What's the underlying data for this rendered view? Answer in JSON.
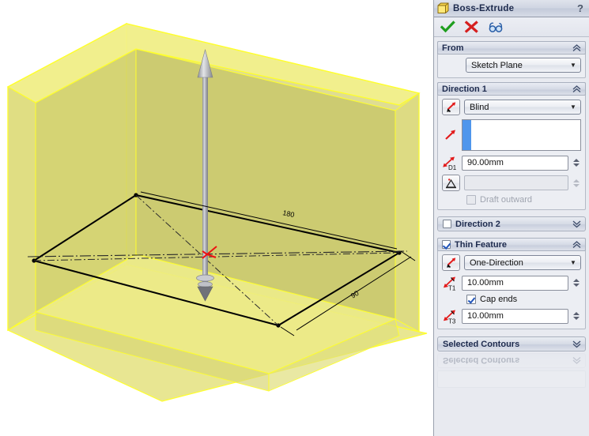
{
  "window": {
    "title": "Boss-Extrude",
    "icon": "boss-extrude-icon",
    "help_label": "?"
  },
  "toolbar": {
    "ok_label": "OK",
    "cancel_label": "Cancel",
    "preview_label": "Detailed Preview"
  },
  "sections": {
    "from": {
      "title": "From",
      "collapse_state": "expanded",
      "start_condition": "Sketch Plane"
    },
    "direction1": {
      "title": "Direction 1",
      "collapse_state": "expanded",
      "reverse_label": "Reverse Direction",
      "end_condition": "Blind",
      "direction_vector": "",
      "depth_label": "D1",
      "depth_value": "90.00mm",
      "draft_label": "Draft Angle",
      "draft_value": "",
      "draft_outward_label": "Draft outward",
      "draft_outward_checked": false
    },
    "direction2": {
      "title": "Direction 2",
      "collapse_state": "collapsed",
      "checked": false
    },
    "thin_feature": {
      "title": "Thin Feature",
      "collapse_state": "expanded",
      "checked": true,
      "reverse_label": "Reverse Direction",
      "thin_type": "One-Direction",
      "t1_label": "T1",
      "t1_value": "10.00mm",
      "cap_ends_label": "Cap ends",
      "cap_ends_checked": true,
      "t3_label": "T3",
      "t3_value": "10.00mm"
    },
    "selected_contours": {
      "title": "Selected Contours",
      "collapse_state": "collapsed",
      "ghost_title": "Selected Contours"
    }
  },
  "viewport": {
    "model_name": "extruded-thin-box-preview",
    "dimension_length": "180",
    "dimension_width": "90",
    "direction_arrow": "extrude-direction-arrow",
    "origin_marker": "sketch-origin"
  },
  "colors": {
    "preview_fill": "#ebe97f",
    "preview_edge": "#ffff22",
    "sketch_edge": "#000000",
    "origin_red": "#ee1111",
    "accent_blue": "#4f96ec",
    "ok_green": "#22aa22",
    "cancel_red": "#d61f1f",
    "header_text": "#1e2b4e"
  }
}
